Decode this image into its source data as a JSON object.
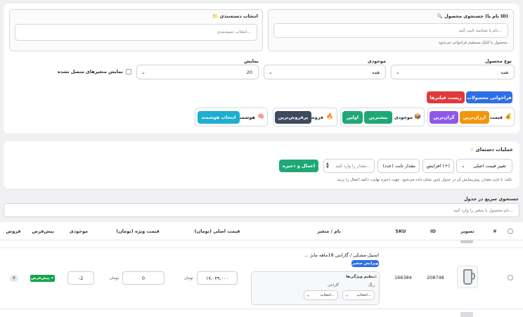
{
  "filters": {
    "product_search": {
      "icon": "search-icon",
      "label": "جستجوی محصول (نام یا ID)",
      "placeholder": "نام یا شناسه تایپ کنید...",
      "hint": "محصول با کلیک مستقیم فراخوانی می‌شود."
    },
    "category": {
      "icon": "folder-icon",
      "label": "انتخاب دسته‌بندی",
      "placeholder": "انتخاب دسته‌بندی..."
    },
    "product_type": {
      "label": "نوع محصول",
      "value": "همه"
    },
    "stock": {
      "label": "موجودی",
      "value": "همه"
    },
    "display": {
      "label": "نمایش",
      "value": "20"
    },
    "hide_unconnected_label": "نمایش متغیرهای متصل نشده",
    "load_button": "فراخوانی محصولات",
    "reset_button": "ریست فیلترها",
    "sort_groups": [
      {
        "label": "قیمت",
        "icon": "money-bag-icon",
        "buttons": [
          {
            "label": "ارزان‌ترین",
            "color": "#f0960c"
          },
          {
            "label": "گران‌ترین",
            "color": "#8e57e8"
          }
        ]
      },
      {
        "label": "موجودی",
        "icon": "box-icon",
        "buttons": [
          {
            "label": "بیشترین",
            "color": "#1fa876"
          },
          {
            "label": "اولین",
            "color": "#1fa876"
          }
        ]
      },
      {
        "label": "فروش",
        "icon": "fire-icon",
        "buttons": [
          {
            "label": "پرفروش‌ترین",
            "color": "#3d4a5d"
          }
        ]
      },
      {
        "label": "هوشمند",
        "icon": "brain-icon",
        "buttons": [
          {
            "label": "انتخاب هوشمند",
            "color": "#1daed0"
          }
        ]
      }
    ]
  },
  "bulk": {
    "icon": "lightning-icon",
    "title": "عملیات دسته‌ای",
    "field_select": "تغییر قیمت اصلی",
    "op_select": "افزایش (+)",
    "mode_select": "مقدار ثابت (عدد)",
    "value_placeholder": "مقدار را وارد کنید...",
    "apply_button": "اعمال و ذخیره",
    "note": "نکته: با تایپ مقدار، پیش‌نمایش آن در جدول پایین نشان داده می‌شود. جهت ذخیره نهایی، دکمه اعمال را بزنید."
  },
  "quick_search": {
    "label": "جستجوی سریع در جدول",
    "placeholder": "نام محصول یا متغیر را وارد کنید..."
  },
  "table": {
    "columns": [
      "#",
      "تصویر",
      "ID",
      "SKU",
      "نام / متغیر",
      "قیمت اصلی (تومان)",
      "قیمت ویژه (تومان)",
      "موجودی",
      "پیش‌فرض",
      "فروش"
    ],
    "row": {
      "id": "208748",
      "sku": "166384",
      "name": "... استیل-مشکی / گارانتی 18ماهه مانژ",
      "edit_badge": "ویرایش متغیر",
      "attr_title": "تنظیم ویژگی‌ها:",
      "attr1_label": "رنگ",
      "attr2_label": "گارانتی",
      "attr1_value": "انتخاب...",
      "attr2_value": "انتخاب...",
      "price": "۱۷,۰۴۹,۰۰۰",
      "price_unit": "تومان",
      "sale_price": "0",
      "sale_unit": "تومان",
      "stock": "-2",
      "default_badge": "پیش‌فرض ✔",
      "sales": "0"
    }
  }
}
